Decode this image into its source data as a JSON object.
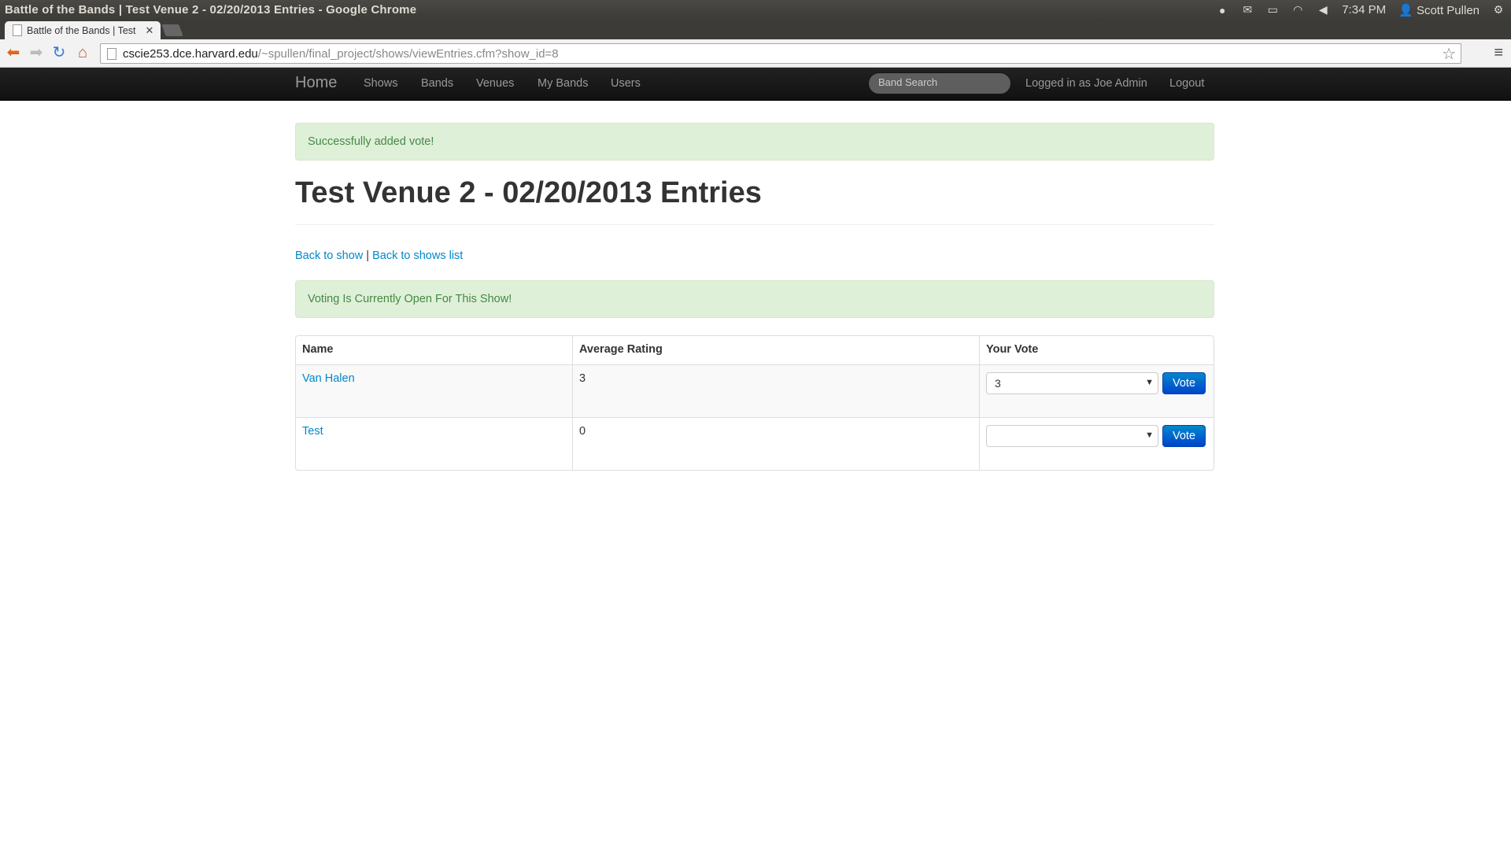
{
  "os_panel": {
    "window_title": "Battle of the Bands | Test Venue 2 - 02/20/2013 Entries - Google Chrome",
    "time": "7:34 PM",
    "user": "Scott Pullen"
  },
  "browser": {
    "tab_title": "Battle of the Bands | Test",
    "url_host": "cscie253.dce.harvard.edu",
    "url_path": "/~spullen/final_project/shows/viewEntries.cfm?show_id=8"
  },
  "navbar": {
    "brand": "Home",
    "items": [
      "Shows",
      "Bands",
      "Venues",
      "My Bands",
      "Users"
    ],
    "search_placeholder": "Band Search",
    "logged_in": "Logged in as Joe Admin",
    "logout": "Logout"
  },
  "page": {
    "success_alert": "Successfully added vote!",
    "title": "Test Venue 2 - 02/20/2013 Entries",
    "back_to_show": "Back to show",
    "separator": "|",
    "back_to_list": "Back to shows list",
    "voting_alert": "Voting Is Currently Open For This Show!"
  },
  "table": {
    "headers": [
      "Name",
      "Average Rating",
      "Your Vote"
    ],
    "rows": [
      {
        "name": "Van Halen",
        "rating": "3",
        "vote_value": "3",
        "button": "Vote"
      },
      {
        "name": "Test",
        "rating": "0",
        "vote_value": "",
        "button": "Vote"
      }
    ]
  }
}
